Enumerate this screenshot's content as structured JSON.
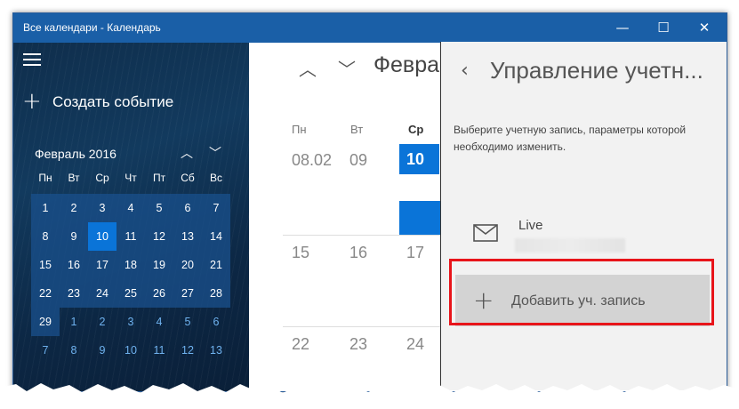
{
  "window": {
    "title": "Все календари - Календарь",
    "minimize": "—",
    "maximize": "☐",
    "close": "✕"
  },
  "sidebar": {
    "new_event": "Создать событие",
    "mini_month": "Февраль 2016",
    "weekdays": [
      "Пн",
      "Вт",
      "Ср",
      "Чт",
      "Пт",
      "Сб",
      "Вс"
    ],
    "weeks": [
      [
        "1",
        "2",
        "3",
        "4",
        "5",
        "6",
        "7"
      ],
      [
        "8",
        "9",
        "10",
        "11",
        "12",
        "13",
        "14"
      ],
      [
        "15",
        "16",
        "17",
        "18",
        "19",
        "20",
        "21"
      ],
      [
        "22",
        "23",
        "24",
        "25",
        "26",
        "27",
        "28"
      ],
      [
        "29",
        "1",
        "2",
        "3",
        "4",
        "5",
        "6"
      ],
      [
        "7",
        "8",
        "9",
        "10",
        "11",
        "12",
        "13"
      ]
    ],
    "today": "10"
  },
  "main": {
    "month": "Февра",
    "weekdays": [
      "Пн",
      "Вт",
      "Ср"
    ],
    "row1": [
      "08.02",
      "09",
      "10"
    ],
    "row2": [
      "15",
      "16",
      "17"
    ],
    "row3": [
      "22",
      "23",
      "24"
    ]
  },
  "panel": {
    "title": "Управление учетн...",
    "description": "Выберите учетную запись, параметры которой необходимо изменить.",
    "account_name": "Live",
    "add_account": "Добавить уч. запись"
  },
  "colors": {
    "accent": "#0a74d8",
    "titlebar": "#1a5fa7",
    "highlight": "#e8141a"
  },
  "icons": [
    "menu-icon",
    "plus-icon",
    "chevron-up-icon",
    "chevron-down-icon",
    "back-icon",
    "mail-icon",
    "minimize-icon",
    "maximize-icon",
    "close-icon"
  ]
}
